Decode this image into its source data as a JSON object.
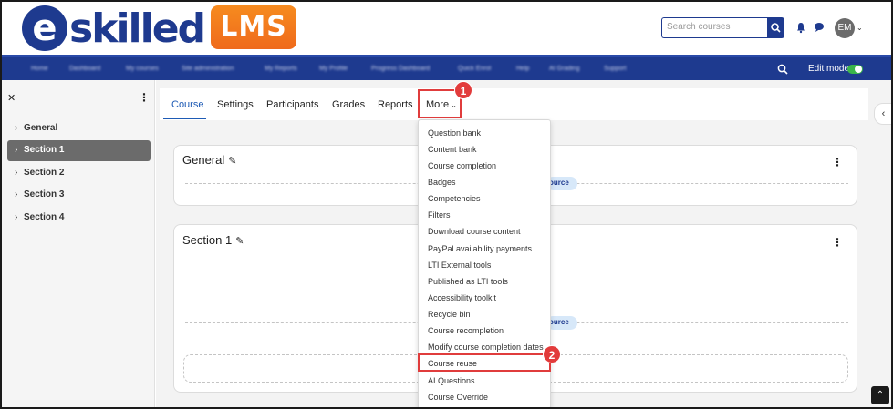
{
  "header": {
    "logo_text": "eskilled",
    "logo_badge": "LMS",
    "search_placeholder": "Search courses",
    "avatar_initials": "EM"
  },
  "navbar": {
    "items": [
      "Home",
      "Dashboard",
      "My courses",
      "Site administration",
      "My Reports",
      "My Profile",
      "Progress Dashboard",
      "Quick Enrol",
      "Help",
      "AI Grading",
      "Support"
    ],
    "edit_mode_label": "Edit mode"
  },
  "drawer": {
    "items": [
      {
        "label": "General"
      },
      {
        "label": "Section 1"
      },
      {
        "label": "Section 2"
      },
      {
        "label": "Section 3"
      },
      {
        "label": "Section 4"
      }
    ]
  },
  "tabs": {
    "course": "Course",
    "settings": "Settings",
    "participants": "Participants",
    "grades": "Grades",
    "reports": "Reports",
    "more": "More"
  },
  "callouts": {
    "first": "1",
    "second": "2"
  },
  "sections": {
    "general_title": "General",
    "section1_title": "Section 1",
    "pill_text": "ource"
  },
  "menu": {
    "items": [
      "Question bank",
      "Content bank",
      "Course completion",
      "Badges",
      "Competencies",
      "Filters",
      "Download course content",
      "PayPal availability payments",
      "LTI External tools",
      "Published as LTI tools",
      "Accessibility toolkit",
      "Recycle bin",
      "Course recompletion",
      "Modify course completion dates",
      "Course reuse",
      "AI Questions",
      "Course Override"
    ]
  },
  "colors": {
    "brand_blue": "#1e3a8f",
    "brand_orange": "#f68b1f",
    "highlight_red": "#e03c3c",
    "active_tab": "#1e5bb5"
  }
}
